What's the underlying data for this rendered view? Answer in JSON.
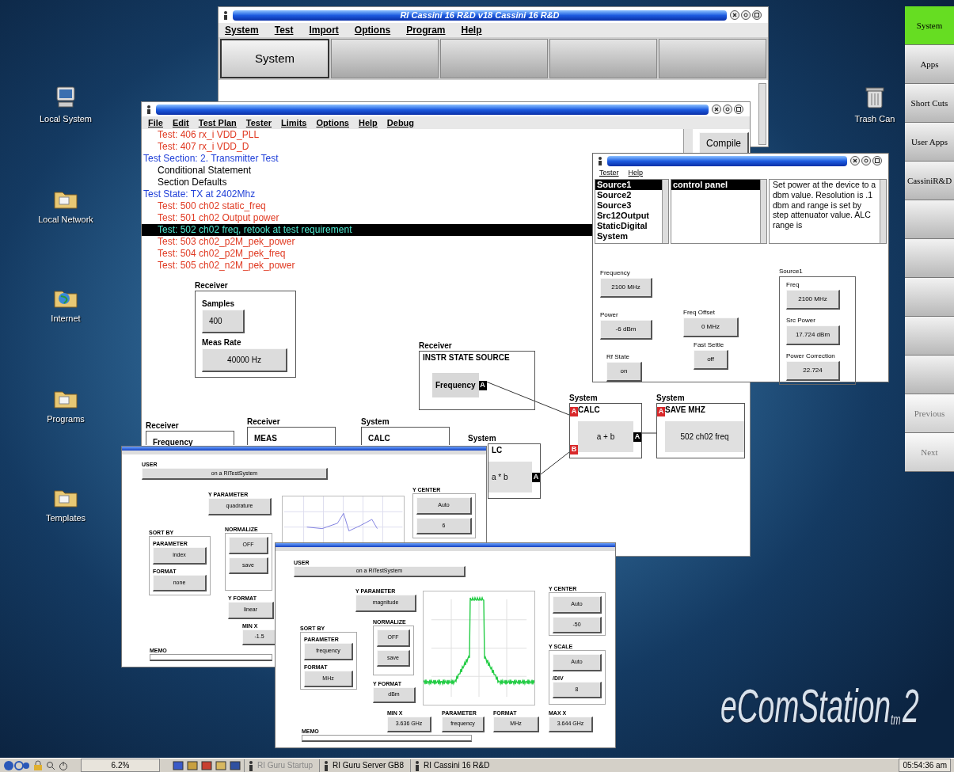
{
  "desktop_icons": [
    {
      "label": "Local System",
      "kind": "computer"
    },
    {
      "label": "Local Network",
      "kind": "network"
    },
    {
      "label": "Internet",
      "kind": "internet"
    },
    {
      "label": "Programs",
      "kind": "programs"
    },
    {
      "label": "Templates",
      "kind": "templates"
    },
    {
      "label": "Trash Can",
      "kind": "trash"
    }
  ],
  "side_panel": [
    {
      "kind": "labeled",
      "label": "System",
      "selected": true,
      "disabled": false
    },
    {
      "kind": "labeled",
      "label": "Apps",
      "selected": false,
      "disabled": false
    },
    {
      "kind": "labeled",
      "label": "Short Cuts",
      "selected": false,
      "disabled": false
    },
    {
      "kind": "labeled",
      "label": "User Apps",
      "selected": false,
      "disabled": false
    },
    {
      "kind": "labeled",
      "label": "CassiniR&D",
      "selected": false,
      "disabled": false
    },
    {
      "kind": "blank",
      "selected": false,
      "disabled": false
    },
    {
      "kind": "blank",
      "selected": false,
      "disabled": false
    },
    {
      "kind": "blank",
      "selected": false,
      "disabled": false
    },
    {
      "kind": "blank",
      "selected": false,
      "disabled": false
    },
    {
      "kind": "blank",
      "selected": false,
      "disabled": false
    },
    {
      "kind": "labeled",
      "label": "Previous",
      "selected": false,
      "disabled": true
    },
    {
      "kind": "labeled",
      "label": "Next",
      "selected": false,
      "disabled": true
    }
  ],
  "cassini_window": {
    "title": "RI Cassini 16 R&D v18  Cassini 16 R&D",
    "menu": [
      "System",
      "Test",
      "Import",
      "Options",
      "Program",
      "Help"
    ],
    "tabs": [
      {
        "kind": "labeled",
        "label": "System",
        "selected": true
      },
      {
        "kind": "blank",
        "selected": false
      },
      {
        "kind": "blank",
        "selected": false
      },
      {
        "kind": "blank",
        "selected": false
      },
      {
        "kind": "blank",
        "selected": false
      }
    ]
  },
  "test_plan_window": {
    "menu": [
      "File",
      "Edit",
      "Test Plan",
      "Tester",
      "Limits",
      "Options",
      "Help",
      "Debug"
    ],
    "lines": [
      {
        "kind": "test",
        "text": "Test: 406 rx_i VDD_PLL",
        "selected": false
      },
      {
        "kind": "test",
        "text": "Test: 407 rx_i VDD_D",
        "selected": false
      },
      {
        "kind": "section",
        "text": "Test Section: 2. Transmitter Test",
        "selected": false
      },
      {
        "kind": "item",
        "text": "Conditional Statement",
        "selected": false
      },
      {
        "kind": "item",
        "text": "Section Defaults",
        "selected": false
      },
      {
        "kind": "state",
        "text": "Test State: TX at 2402Mhz",
        "selected": false
      },
      {
        "kind": "test",
        "text": "Test: 500 ch02 static_freq",
        "selected": false
      },
      {
        "kind": "test",
        "text": "Test: 501 ch02 Output power",
        "selected": false
      },
      {
        "kind": "test",
        "text": "Test: 502 ch02 freq, retook at test requirement",
        "selected": true
      },
      {
        "kind": "test",
        "text": "Test: 503 ch02_p2M_pek_power",
        "selected": false
      },
      {
        "kind": "test",
        "text": "Test: 504 ch02_p2M_pek_freq",
        "selected": false
      },
      {
        "kind": "test",
        "text": "Test: 505 ch02_n2M_pek_power",
        "selected": false
      }
    ],
    "compile_button": "Compile",
    "nodes": [
      {
        "kind": "settings",
        "category": "Receiver",
        "fields": [
          {
            "label": "Samples",
            "value": "400"
          },
          {
            "label": "Meas Rate",
            "value": "40000 Hz"
          }
        ]
      },
      {
        "kind": "source",
        "category": "Receiver",
        "title": "INSTR STATE SOURCE",
        "button": "Frequency",
        "out_port": "A"
      },
      {
        "kind": "calc",
        "category": "System",
        "title": "CALC",
        "in_ports": [
          "A",
          "B"
        ],
        "expression": "a + b",
        "out_port": "A"
      },
      {
        "kind": "save",
        "category": "System",
        "title": "SAVE MHZ",
        "in_ports": [
          "A"
        ],
        "text": "502 ch02 freq"
      },
      {
        "kind": "stub",
        "category": "Receiver",
        "title": "Frequency"
      },
      {
        "kind": "stub",
        "category": "Receiver",
        "title": "MEAS"
      },
      {
        "kind": "stub",
        "category": "System",
        "title": "CALC"
      },
      {
        "kind": "calc",
        "category": "System",
        "title": "LC",
        "expression": "a * b",
        "out_port": "A"
      }
    ]
  },
  "controller_dialog": {
    "menu": [
      "Tester",
      "Help"
    ],
    "list_1": [
      {
        "label": "Source1",
        "selected": true
      },
      {
        "label": "Source2",
        "selected": false
      },
      {
        "label": "Source3",
        "selected": false
      },
      {
        "label": "Src12Output",
        "selected": false
      },
      {
        "label": "StaticDigital",
        "selected": false
      },
      {
        "label": "System",
        "selected": false
      }
    ],
    "list_2": [
      {
        "label": "control panel",
        "selected": true
      }
    ],
    "description": "Set power at the device to a dbm value. Resolution is .1 dbm and range is set by step attenuator value.  ALC range is",
    "controls": [
      {
        "label": "Frequency",
        "value": "2100 MHz"
      },
      {
        "label": "Power",
        "value": "-6 dBm"
      },
      {
        "label": "Rf State",
        "value": "on"
      },
      {
        "label": "Freq Offset",
        "value": "0 MHz"
      },
      {
        "label": "Fast Settle",
        "value": "off"
      }
    ],
    "group": {
      "title": "Source1",
      "controls": [
        {
          "label": "Freq",
          "value": "2100 MHz"
        },
        {
          "label": "Src Power",
          "value": "17.724 dBm"
        },
        {
          "label": "Power Correction",
          "value": "22.724"
        }
      ]
    }
  },
  "analyzer_windows": [
    {
      "controls": [
        {
          "kind": "field",
          "label": "USER",
          "value": "on a RiTestSystem"
        },
        {
          "kind": "field",
          "label": "Y PARAMETER",
          "value": "quadrature"
        },
        {
          "kind": "iq-plot"
        },
        {
          "kind": "group",
          "label": "Y CENTER",
          "items": [
            {
              "value": "Auto"
            },
            {
              "value": "6"
            }
          ]
        },
        {
          "kind": "group",
          "label": "SORT BY",
          "items": [
            {
              "label": "PARAMETER",
              "value": "index"
            },
            {
              "label": "FORMAT",
              "value": "none"
            }
          ]
        },
        {
          "kind": "group",
          "label": "NORMALIZE",
          "items": [
            {
              "value": "OFF"
            },
            {
              "value": "save"
            }
          ]
        },
        {
          "kind": "field",
          "label": "Y FORMAT",
          "value": "linear"
        },
        {
          "kind": "field",
          "label": "MIN X",
          "value": "-1.5"
        },
        {
          "kind": "memo",
          "label": "MEMO"
        }
      ]
    },
    {
      "controls": [
        {
          "kind": "field",
          "label": "USER",
          "value": "on a RiTestSystem"
        },
        {
          "kind": "field",
          "label": "Y PARAMETER",
          "value": "magnitude"
        },
        {
          "kind": "spectrum-plot"
        },
        {
          "kind": "group",
          "label": "Y CENTER",
          "items": [
            {
              "value": "Auto"
            },
            {
              "value": "-50"
            }
          ]
        },
        {
          "kind": "group",
          "label": "Y SCALE",
          "items": [
            {
              "value": "Auto"
            },
            {
              "label": "/DIV",
              "value": "8"
            }
          ]
        },
        {
          "kind": "group",
          "label": "SORT BY",
          "items": [
            {
              "label": "PARAMETER",
              "value": "frequency"
            },
            {
              "label": "FORMAT",
              "value": "MHz"
            }
          ]
        },
        {
          "kind": "group",
          "label": "NORMALIZE",
          "items": [
            {
              "value": "OFF"
            },
            {
              "value": "save"
            }
          ]
        },
        {
          "kind": "field",
          "label": "Y FORMAT",
          "value": "dBm"
        },
        {
          "kind": "field",
          "label": "MIN X",
          "value": "3.636 GHz"
        },
        {
          "kind": "field",
          "label": "PARAMETER",
          "value": "frequency"
        },
        {
          "kind": "field",
          "label": "FORMAT",
          "value": "MHz"
        },
        {
          "kind": "field",
          "label": "MAX X",
          "value": "3.644 GHz"
        },
        {
          "kind": "memo",
          "label": "MEMO"
        }
      ]
    }
  ],
  "logo": {
    "name": "eComStation",
    "tm": "tm",
    "version": "2"
  },
  "taskbar": {
    "cpu": "6.2%",
    "tasks": [
      {
        "label": "RI Guru Startup",
        "disabled": true
      },
      {
        "label": "RI Guru Server GB8",
        "disabled": false
      },
      {
        "label": "RI Cassini 16 R&D",
        "disabled": false
      }
    ],
    "clock": "05:54:36 am"
  }
}
